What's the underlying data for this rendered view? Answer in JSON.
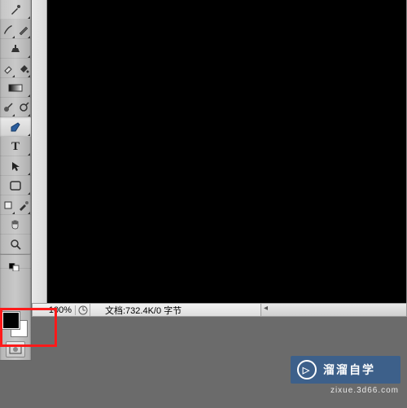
{
  "tools": [
    {
      "name": "brush-tool"
    },
    {
      "name": "history-brush-tool"
    },
    {
      "name": "pencil-tool"
    },
    {
      "name": "clone-stamp-tool"
    },
    {
      "name": "eraser-tool"
    },
    {
      "name": "paint-bucket-tool"
    },
    {
      "name": "gradient-tool"
    },
    {
      "name": "smudge-tool"
    },
    {
      "name": "dodge-tool"
    },
    {
      "name": "pen-tool"
    },
    {
      "name": "type-tool",
      "label": "T"
    },
    {
      "name": "path-select-tool"
    },
    {
      "name": "shape-tool"
    },
    {
      "name": "hand-tool"
    },
    {
      "name": "zoom-tool"
    }
  ],
  "status": {
    "zoom": "100%",
    "doc_label": "文档:732.4K/0 字节"
  },
  "colors": {
    "foreground": "#000000",
    "background": "#ffffff"
  },
  "watermark": {
    "text": "溜溜自学",
    "url": "zixue.3d66.com"
  }
}
